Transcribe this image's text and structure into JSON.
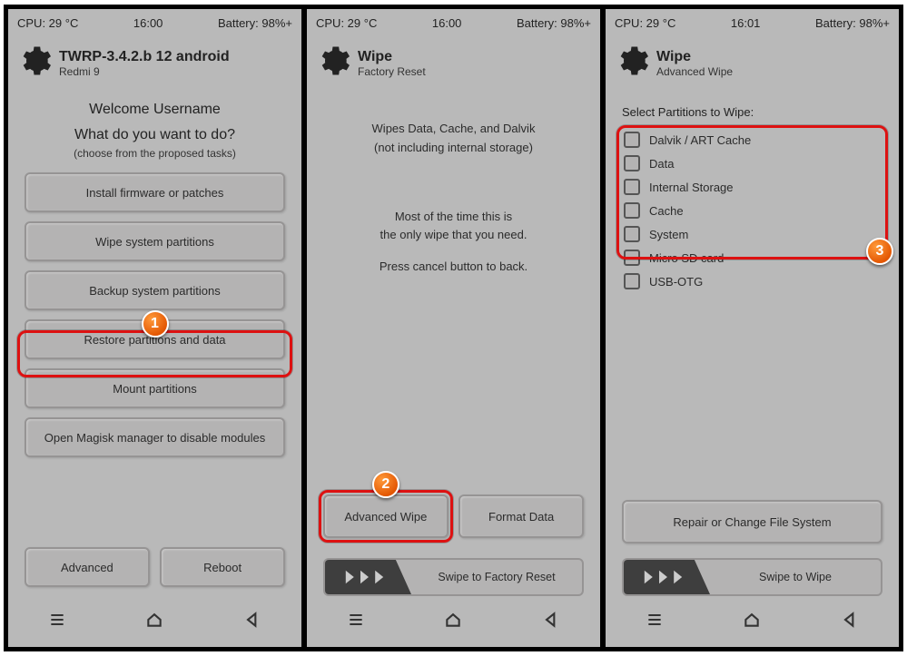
{
  "screens": [
    {
      "status": {
        "cpu": "CPU: 29 °C",
        "time": "16:00",
        "battery": "Battery: 98%+"
      },
      "header": {
        "title": "TWRP-3.4.2.b 12 android",
        "subtitle": "Redmi 9"
      },
      "welcome_line1": "Welcome Username",
      "welcome_line2": "What do you want to do?",
      "choose": "(choose from the proposed tasks)",
      "buttons": [
        "Install firmware or patches",
        "Wipe system partitions",
        "Backup system partitions",
        "Restore partitions and data",
        "Mount partitions",
        "Open Magisk manager to disable modules"
      ],
      "bottom": {
        "left": "Advanced",
        "right": "Reboot"
      },
      "badge": "1"
    },
    {
      "status": {
        "cpu": "CPU: 29 °C",
        "time": "16:00",
        "battery": "Battery: 98%+"
      },
      "header": {
        "title": "Wipe",
        "subtitle": "Factory Reset"
      },
      "info1a": "Wipes Data, Cache, and Dalvik",
      "info1b": "(not including internal storage)",
      "info2a": "Most of the time this is",
      "info2b": "the only wipe that you need.",
      "info3": "Press cancel button to back.",
      "bottom": {
        "left": "Advanced Wipe",
        "right": "Format Data"
      },
      "slider_label": "Swipe to Factory Reset",
      "badge": "2"
    },
    {
      "status": {
        "cpu": "CPU: 29 °C",
        "time": "16:01",
        "battery": "Battery: 98%+"
      },
      "header": {
        "title": "Wipe",
        "subtitle": "Advanced Wipe"
      },
      "select_label": "Select Partitions to Wipe:",
      "partitions": [
        "Dalvik / ART Cache",
        "Data",
        "Internal Storage",
        "Cache",
        "System",
        "Micro SD card",
        "USB-OTG"
      ],
      "repair": "Repair or Change File System",
      "slider_label": "Swipe to Wipe",
      "badge": "3"
    }
  ]
}
